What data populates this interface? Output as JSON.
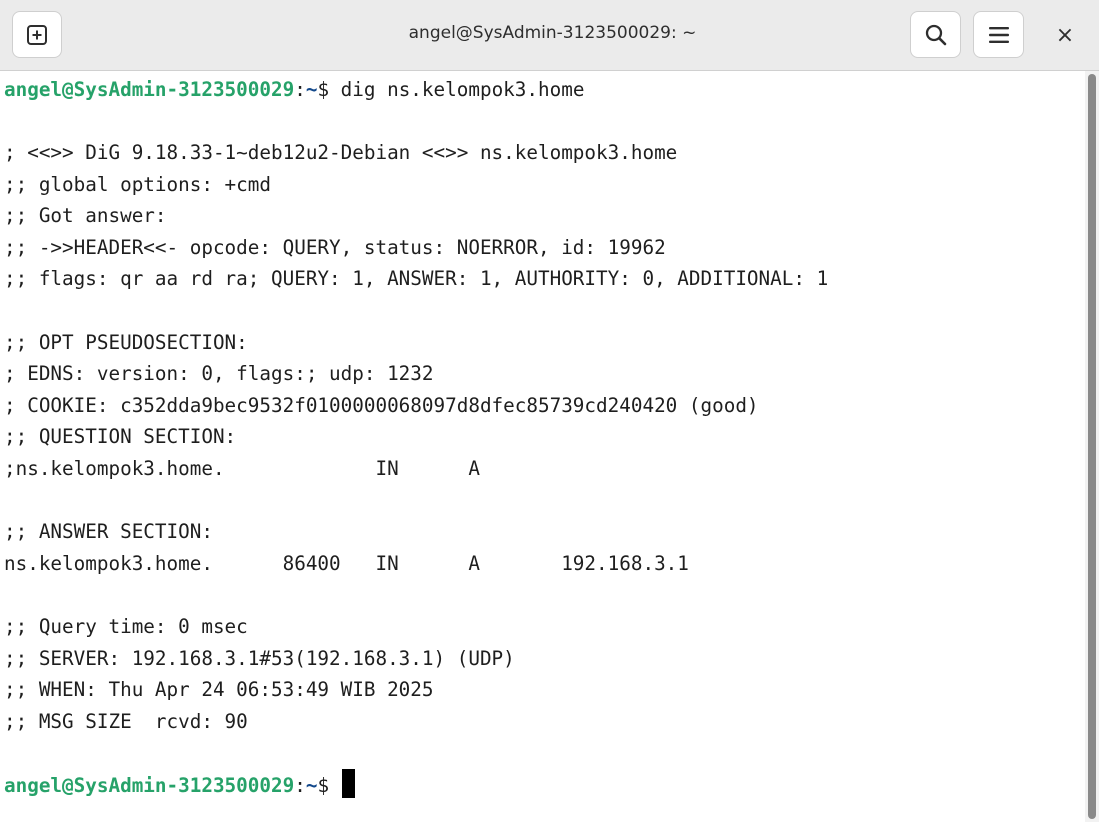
{
  "window": {
    "title": "angel@SysAdmin-3123500029: ~",
    "buttons": {
      "new_tab_icon": "plus-square-icon",
      "search_icon": "search-icon",
      "menu_icon": "hamburger-menu-icon",
      "close_icon": "close-icon",
      "close_glyph": "×"
    }
  },
  "colors": {
    "prompt_user": "#26a269",
    "prompt_path": "#12488b",
    "text": "#1e1e1e",
    "background": "#ffffff"
  },
  "terminal": {
    "prompt": {
      "user_host": "angel@SysAdmin-3123500029",
      "sep": ":",
      "path": "~",
      "symbol": "$"
    },
    "command": " dig ns.kelompok3.home",
    "output": [
      "; <<>> DiG 9.18.33-1~deb12u2-Debian <<>> ns.kelompok3.home",
      ";; global options: +cmd",
      ";; Got answer:",
      ";; ->>HEADER<<- opcode: QUERY, status: NOERROR, id: 19962",
      ";; flags: qr aa rd ra; QUERY: 1, ANSWER: 1, AUTHORITY: 0, ADDITIONAL: 1",
      ";; OPT PSEUDOSECTION:",
      "; EDNS: version: 0, flags:; udp: 1232",
      "; COOKIE: c352dda9bec9532f0100000068097d8dfec85739cd240420 (good)",
      ";; QUESTION SECTION:",
      ";ns.kelompok3.home.             IN      A",
      ";; ANSWER SECTION:",
      "ns.kelompok3.home.      86400   IN      A       192.168.3.1",
      ";; Query time: 0 msec",
      ";; SERVER: 192.168.3.1#53(192.168.3.1) (UDP)",
      ";; WHEN: Thu Apr 24 06:53:49 WIB 2025",
      ";; MSG SIZE  rcvd: 90"
    ],
    "final_command": " "
  }
}
